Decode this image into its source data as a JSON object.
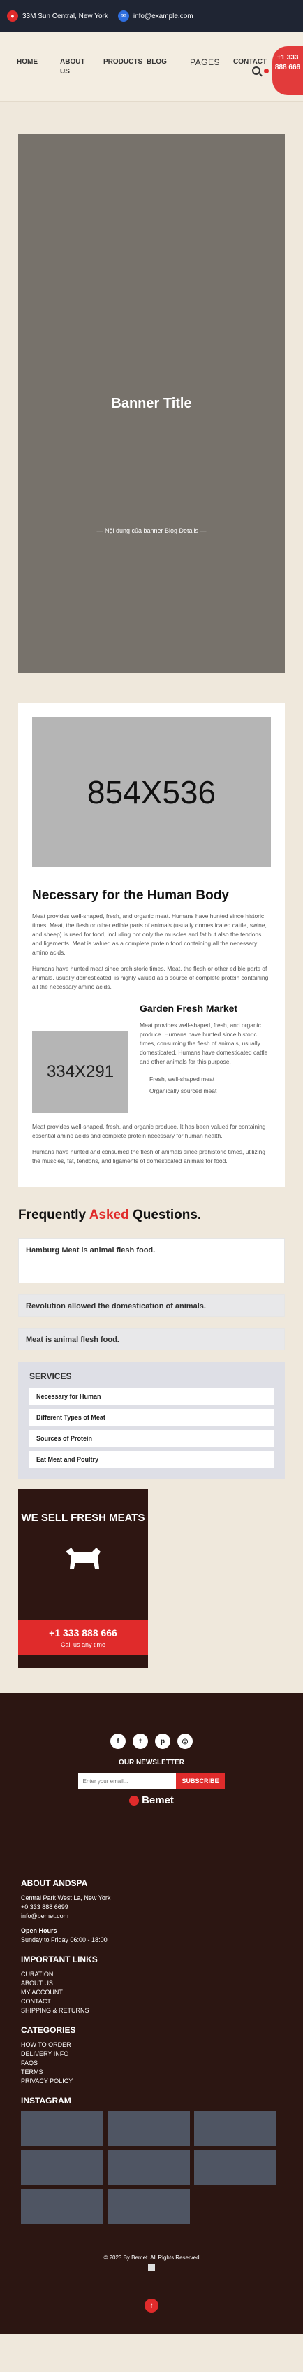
{
  "topbar": {
    "address": "33M Sun Central, New York",
    "email": "info@example.com"
  },
  "nav": {
    "items": [
      "HOME",
      "ABOUT US",
      "PRODUCTS",
      "BLOG",
      "PAGES",
      "CONTACT"
    ],
    "phone": "+1 333 888 666"
  },
  "banner": {
    "title": "Banner Title",
    "subtitle": "— Nội dung của banner Blog Details —"
  },
  "article": {
    "image_label": "854X536",
    "heading": "Necessary for the Human Body",
    "p1": "Meat provides well-shaped, fresh, and organic meat. Humans have hunted since historic times. Meat, the flesh or other edible parts of animals (usually domesticated cattle, swine, and sheep) is used for food, including not only the muscles and fat but also the tendons and ligaments. Meat is valued as a complete protein food containing all the necessary amino acids.",
    "p2": "Humans have hunted meat since prehistoric times. Meat, the flesh or other edible parts of animals, usually domesticated, is highly valued as a source of complete protein containing all the necessary amino acids.",
    "small_image_label": "334X291",
    "sub_heading": "Garden Fresh Market",
    "sub_p": "Meat provides well-shaped, fresh, and organic produce. Humans have hunted since historic times, consuming the flesh of animals, usually domesticated. Humans have domesticated cattle and other animals for this purpose.",
    "bullets": [
      "Fresh, well-shaped meat",
      "Organically sourced meat"
    ],
    "p3": "Meat provides well-shaped, fresh, and organic produce. It has been valued for containing essential amino acids and complete protein necessary for human health.",
    "p4": "Humans have hunted and consumed the flesh of animals since prehistoric times, utilizing the muscles, fat, tendons, and ligaments of domesticated animals for food."
  },
  "faq": {
    "title_prefix": "Frequently",
    "title_accent": "Asked",
    "title_suffix": "Questions.",
    "questions": [
      "Hamburg Meat is animal flesh food.",
      "Revolution allowed the domestication of animals.",
      "Meat is animal flesh food."
    ]
  },
  "services": {
    "title": "SERVICES",
    "items": [
      "Necessary for Human",
      "Different Types of Meat",
      "Sources of Protein",
      "Eat Meat and Poultry"
    ]
  },
  "promo": {
    "title": "WE SELL FRESH MEATS",
    "phone": "+1 333 888 666",
    "cta": "Call us any time"
  },
  "footer": {
    "newsletter": "OUR NEWSLETTER",
    "email_placeholder": "Enter your email...",
    "subscribe": "SUBSCRIBE",
    "brand": "Bemet",
    "about_title": "ABOUT ANDSPA",
    "about_lines": [
      "Central Park West La, New York",
      "+0 333 888 6699",
      "info@bemet.com"
    ],
    "hours_title": "Open Hours",
    "hours": "Sunday to Friday 06:00 - 18:00",
    "links_title": "IMPORTANT LINKS",
    "links": [
      "CURATION",
      "ABOUT US",
      "MY ACCOUNT",
      "CONTACT",
      "SHIPPING & RETURNS"
    ],
    "categories_title": "CATEGORIES",
    "categories": [
      "HOW TO ORDER",
      "DELIVERY INFO",
      "FAQS",
      "TERMS",
      "PRIVACY POLICY"
    ],
    "instagram_title": "INSTAGRAM",
    "copyright": "© 2023 By Bemet. All Rights Reserved"
  }
}
